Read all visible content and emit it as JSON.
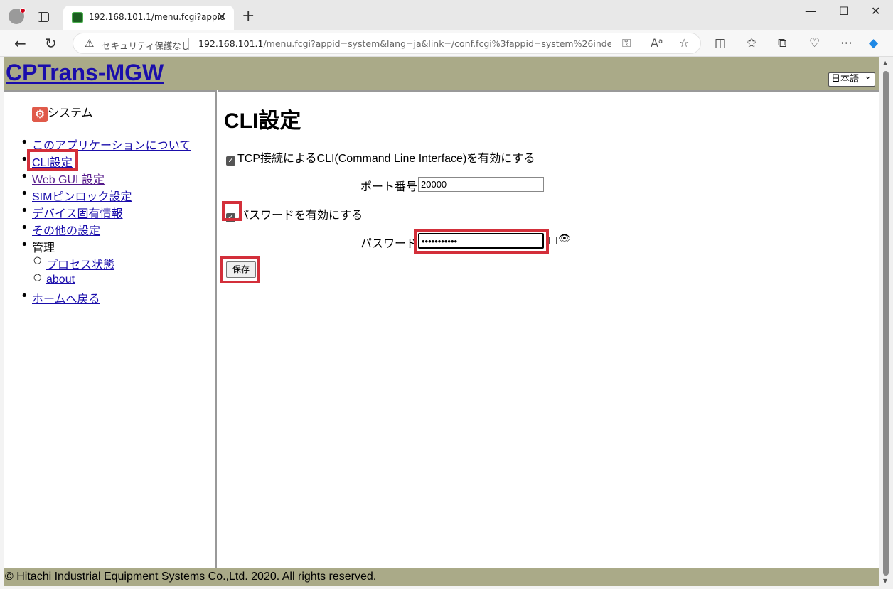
{
  "browser": {
    "tab_title": "192.168.101.1/menu.fcgi?appid=system",
    "security_label": "セキュリティ保護なし",
    "url_host": "192.168.101.1",
    "url_rest": "/menu.fcgi?appid=system&lang=ja&link=/conf.fcgi%3fappid=system%26inde..."
  },
  "header": {
    "app_title": "CPTrans-MGW",
    "language": "日本語"
  },
  "sidebar": {
    "section_title": "システム",
    "items": [
      {
        "label": "このアプリケーションについて"
      },
      {
        "label": "CLI設定"
      },
      {
        "label": "Web GUI 設定"
      },
      {
        "label": "SIMピンロック設定"
      },
      {
        "label": "デバイス固有情報"
      },
      {
        "label": "その他の設定"
      },
      {
        "label": "管理"
      },
      {
        "label": "ホームへ戻る"
      }
    ],
    "sub_items": [
      {
        "label": "プロセス状態"
      },
      {
        "label": "about"
      }
    ]
  },
  "main": {
    "title": "CLI設定",
    "tcp_cli_label": "TCP接続によるCLI(Command Line Interface)を有効にする",
    "tcp_cli_checked": true,
    "port_label": "ポート番号",
    "port_value": "20000",
    "password_enable_label": "パスワードを有効にする",
    "password_enable_checked": true,
    "password_label": "パスワード",
    "password_value": "•••••••••••",
    "save_label": "保存"
  },
  "footer": {
    "text": "© Hitachi Industrial Equipment Systems Co.,Ltd. 2020. All rights reserved."
  },
  "colors": {
    "header_bg": "#aaaa88",
    "link": "#1a0dab",
    "highlight": "#d32f3a"
  }
}
